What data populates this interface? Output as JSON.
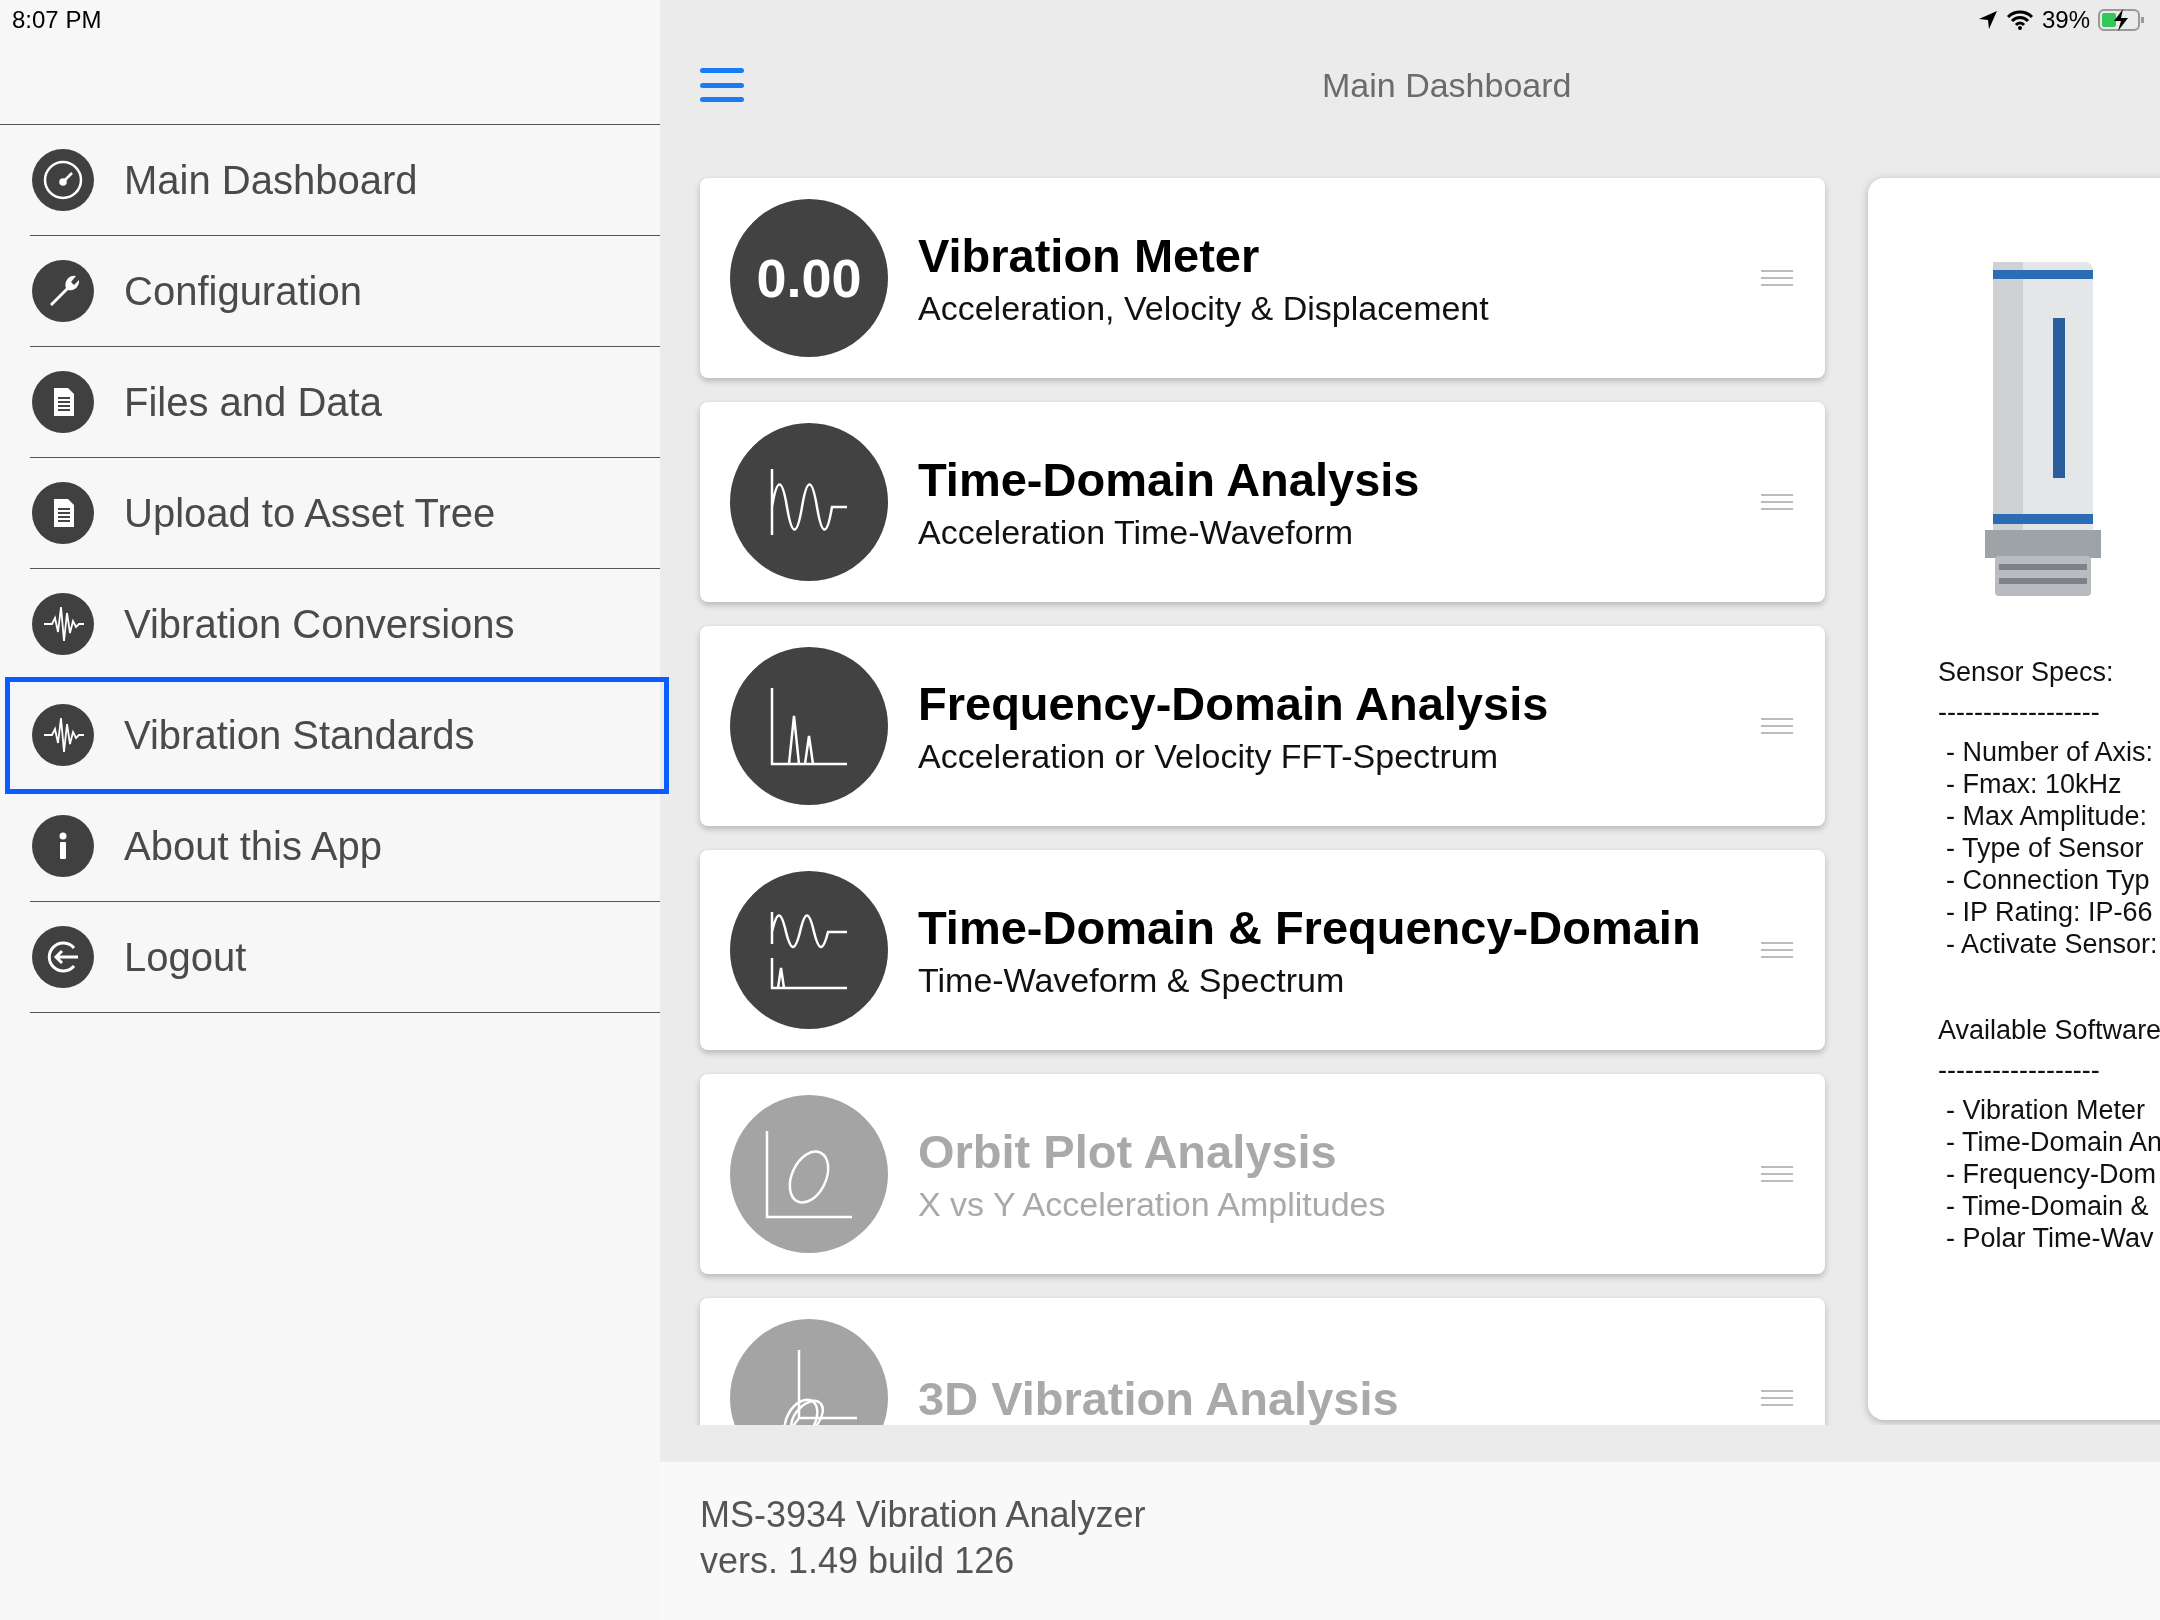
{
  "status_bar": {
    "time": "8:07 PM",
    "battery": "39%"
  },
  "sidebar": {
    "items": [
      {
        "label": "Main Dashboard",
        "kind": "gauge",
        "selected": false
      },
      {
        "label": "Configuration",
        "kind": "wrench",
        "selected": false
      },
      {
        "label": "Files and Data",
        "kind": "document",
        "selected": false
      },
      {
        "label": "Upload to Asset Tree",
        "kind": "document",
        "selected": false
      },
      {
        "label": "Vibration Conversions",
        "kind": "wave",
        "selected": false
      },
      {
        "label": "Vibration Standards",
        "kind": "wave",
        "selected": true
      },
      {
        "label": "About this App",
        "kind": "info",
        "selected": false
      },
      {
        "label": "Logout",
        "kind": "logout",
        "selected": false
      }
    ]
  },
  "header": {
    "title": "Main Dashboard"
  },
  "modules": [
    {
      "kind": "number",
      "badge": "0.00",
      "title": "Vibration Meter",
      "subtitle": "Acceleration, Velocity & Displacement",
      "disabled": false
    },
    {
      "kind": "wave",
      "title": "Time-Domain Analysis",
      "subtitle": "Acceleration Time-Waveform",
      "disabled": false
    },
    {
      "kind": "spectrum",
      "title": "Frequency-Domain Analysis",
      "subtitle": "Acceleration or Velocity FFT-Spectrum",
      "disabled": false
    },
    {
      "kind": "wave-spectrum",
      "title": "Time-Domain & Frequency-Domain",
      "subtitle": "Time-Waveform & Spectrum",
      "disabled": false
    },
    {
      "kind": "orbit",
      "title": "Orbit Plot Analysis",
      "subtitle": "X vs Y Acceleration Amplitudes",
      "disabled": true
    },
    {
      "kind": "spiral",
      "title": "3D Vibration Analysis",
      "disabled": true
    }
  ],
  "sensor_panel": {
    "sections": [
      {
        "heading": "Sensor Specs:",
        "rule": "------------------",
        "lines": [
          "- Number of Axis:",
          "- Fmax: 10kHz",
          "- Max Amplitude:",
          "- Type of Sensor",
          "- Connection Typ",
          "- IP Rating: IP-66",
          "- Activate Sensor:"
        ]
      },
      {
        "heading": "Available Software",
        "rule": "------------------",
        "lines": [
          "- Vibration Meter",
          "- Time-Domain An",
          "- Frequency-Dom",
          "- Time-Domain &",
          "- Polar Time-Wav"
        ]
      }
    ]
  },
  "footer": {
    "lines": [
      "MS-3934 Vibration Analyzer",
      "vers. 1.49 build 126"
    ]
  }
}
